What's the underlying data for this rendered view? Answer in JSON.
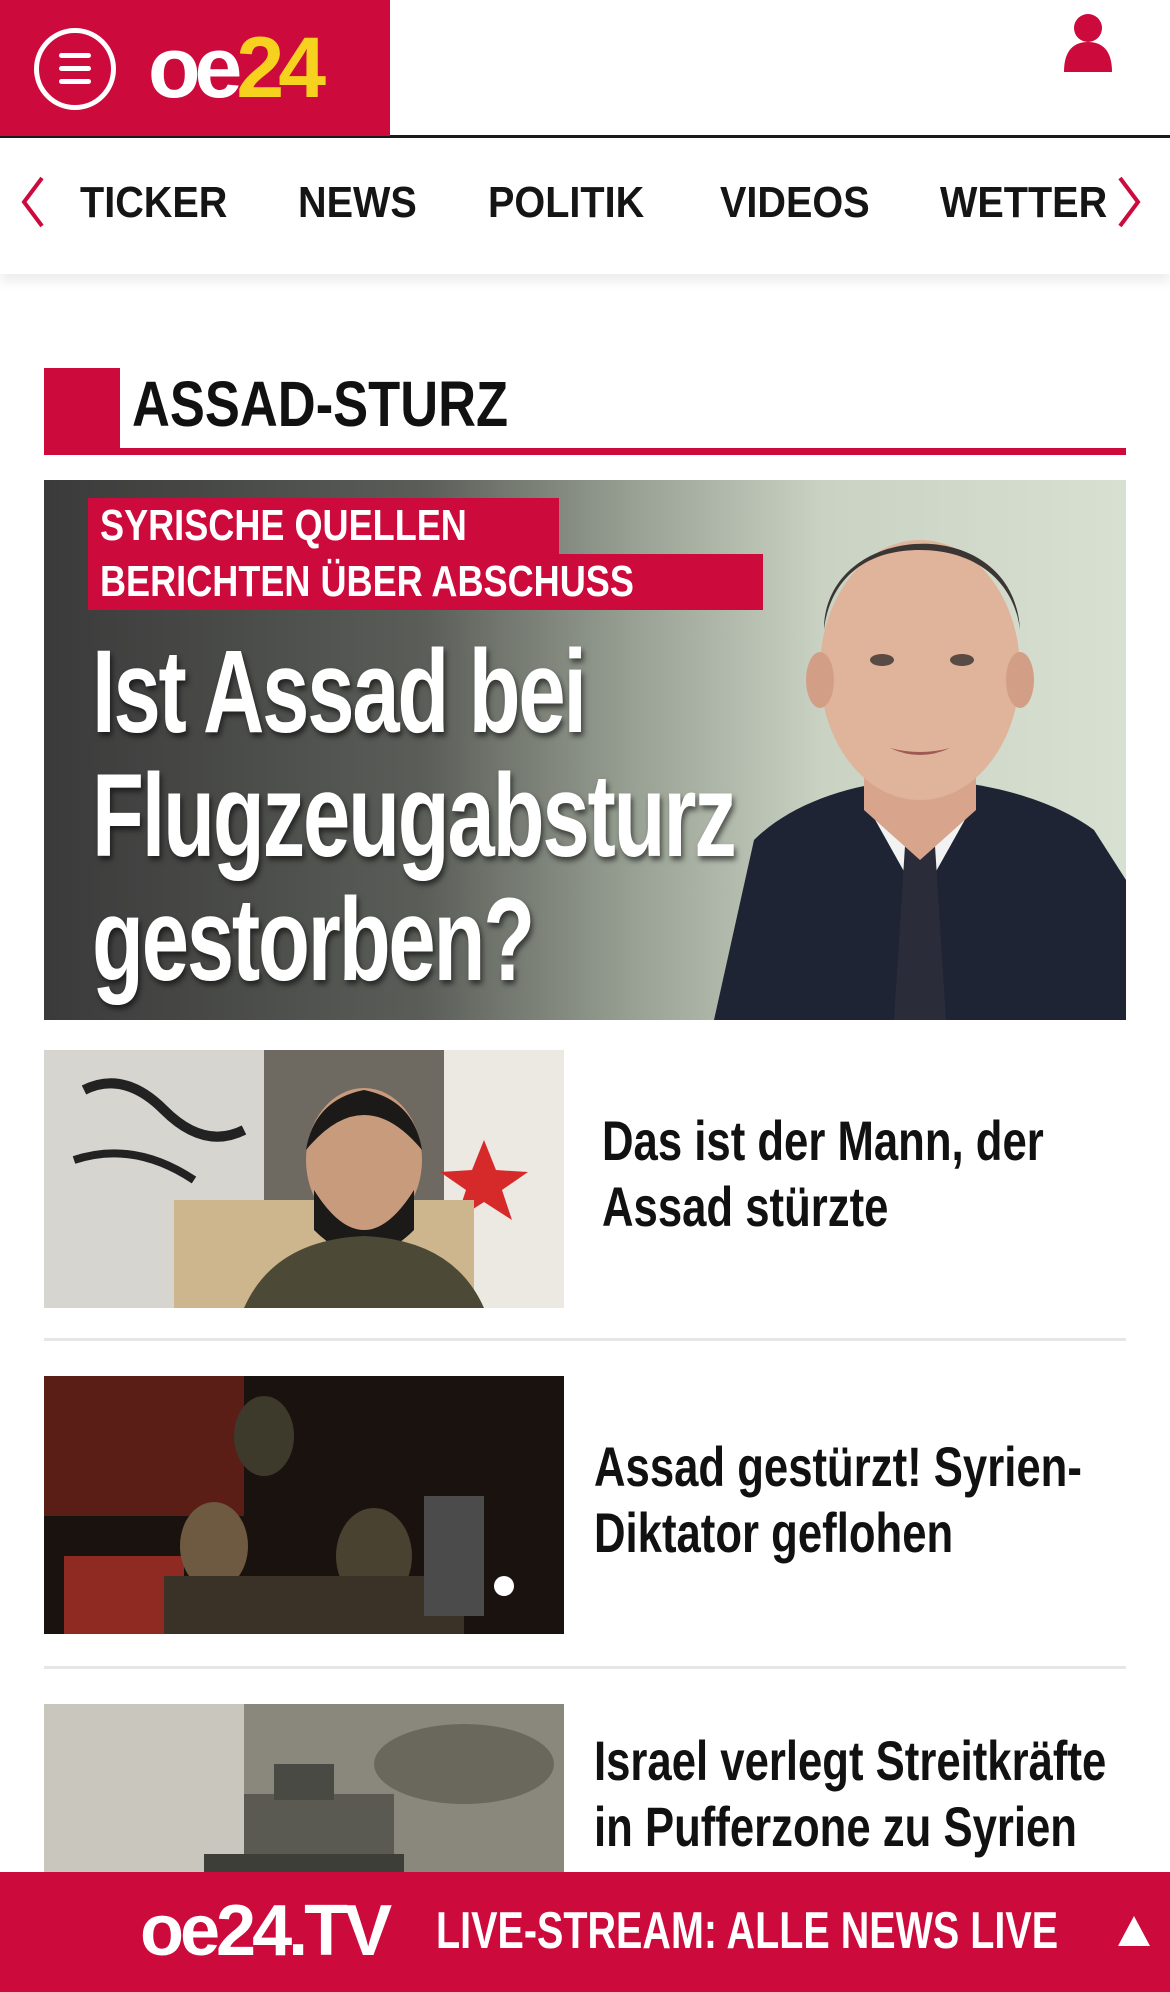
{
  "header": {
    "logo_oe": "oe",
    "logo_num": "24",
    "menu_icon": "hamburger-menu-icon",
    "user_icon": "user-icon",
    "brand_color": "#cc0a3c",
    "logo_accent": "#f6d21f"
  },
  "nav": {
    "prev_icon": "chevron-left-icon",
    "next_icon": "chevron-right-icon",
    "items": [
      {
        "label": "TICKER"
      },
      {
        "label": "NEWS"
      },
      {
        "label": "POLITIK"
      },
      {
        "label": "VIDEOS"
      },
      {
        "label": "WETTER"
      }
    ]
  },
  "section": {
    "title": "ASSAD-STURZ"
  },
  "hero": {
    "kicker_line1": "SYRISCHE QUELLEN",
    "kicker_line2": "BERICHTEN ÜBER ABSCHUSS",
    "headline_line1": "Ist Assad bei",
    "headline_line2": "Flugzeugabsturz",
    "headline_line3": "gestorben?"
  },
  "articles": [
    {
      "headline": "Das ist der Mann, der Assad stürzte"
    },
    {
      "headline": "Assad gestürzt! Syrien-Diktator geflohen"
    },
    {
      "headline": "Israel verlegt Streitkräfte in Pufferzone zu Syrien"
    }
  ],
  "live_bar": {
    "logo": "oe24.TV",
    "text": "LIVE-STREAM:  ALLE NEWS LIVE",
    "up_icon": "triangle-up-icon"
  }
}
